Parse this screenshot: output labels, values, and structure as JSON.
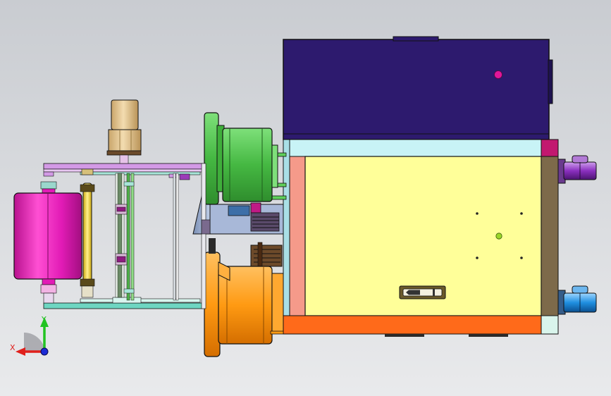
{
  "viewport": {
    "background_top": "#c9ccd1",
    "background_bottom": "#e9eaec"
  },
  "colors": {
    "motor_body": "#2d1a6e",
    "frame_light_blue": "#c8f3f6",
    "plate_yellow": "#ffff99",
    "side_salmon": "#f59a8a",
    "side_brown": "#7d6a4a",
    "bottom_orange": "#ff6a1a",
    "magenta_dot": "#e0169a",
    "green_flange": "#4ec74a",
    "orange_flange": "#ff9a12",
    "magenta_roller": "#e21bb6",
    "yellow_rod": "#f2d23a",
    "tan_cylinder": "#e7c793",
    "purple_wheel": "#8a2fbe",
    "blue_wheel": "#1f8fe0",
    "rail_cyan": "#6ed6c2",
    "rail_lavender": "#d39ae6"
  },
  "triad": {
    "x_label": "X",
    "y_label": "Y",
    "x_color": "#e0201c",
    "y_color": "#21c321",
    "z_color": "#1c2bd6"
  },
  "icons": [
    "coordinate-triad-icon",
    "slot-handle-icon"
  ]
}
